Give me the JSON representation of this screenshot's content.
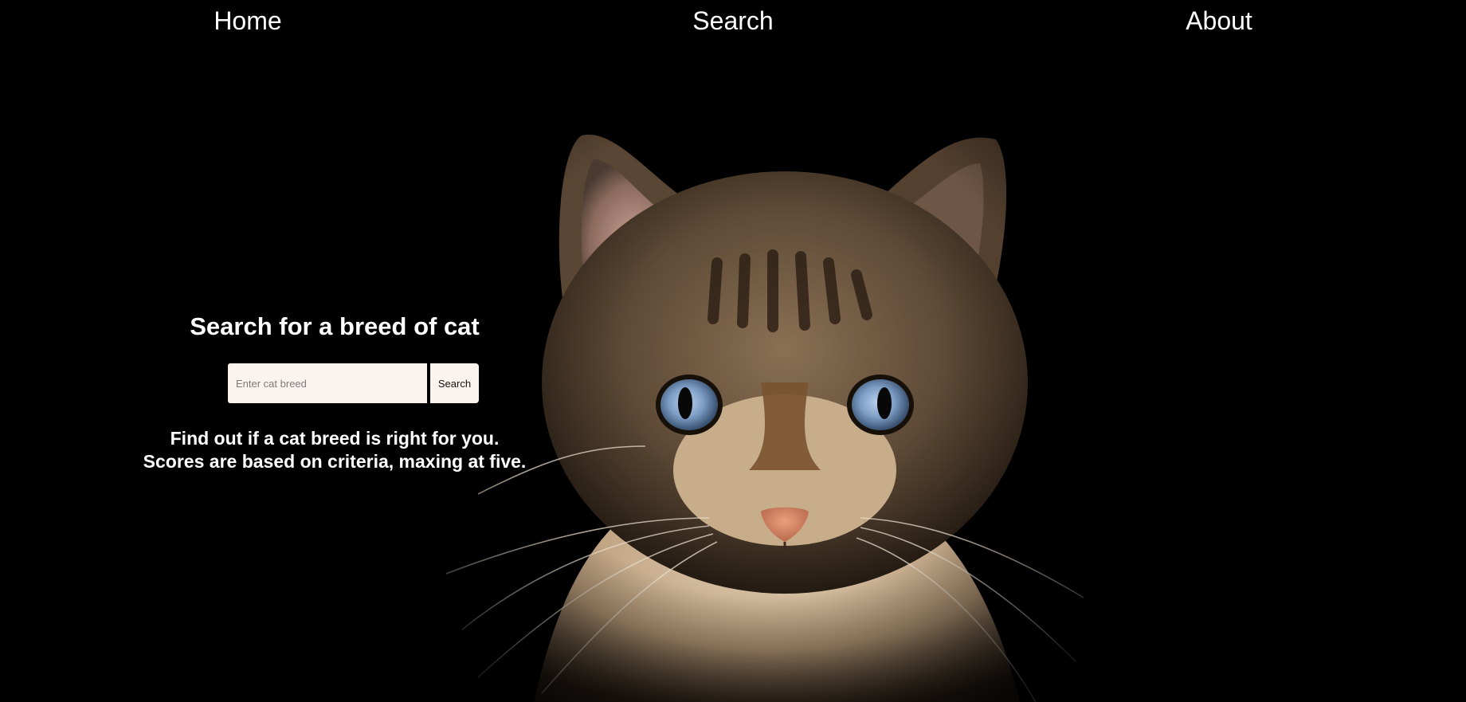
{
  "nav": {
    "home": "Home",
    "search": "Search",
    "about": "About"
  },
  "search": {
    "title": "Search for a breed of cat",
    "input_placeholder": "Enter cat breed",
    "input_value": "",
    "button_label": "Search",
    "description_line1": "Find out if a cat breed is right for you.",
    "description_line2": "Scores are based on criteria, maxing at five."
  },
  "colors": {
    "background": "#000000",
    "text": "#ffffff",
    "input_background": "#fbf3ee"
  }
}
